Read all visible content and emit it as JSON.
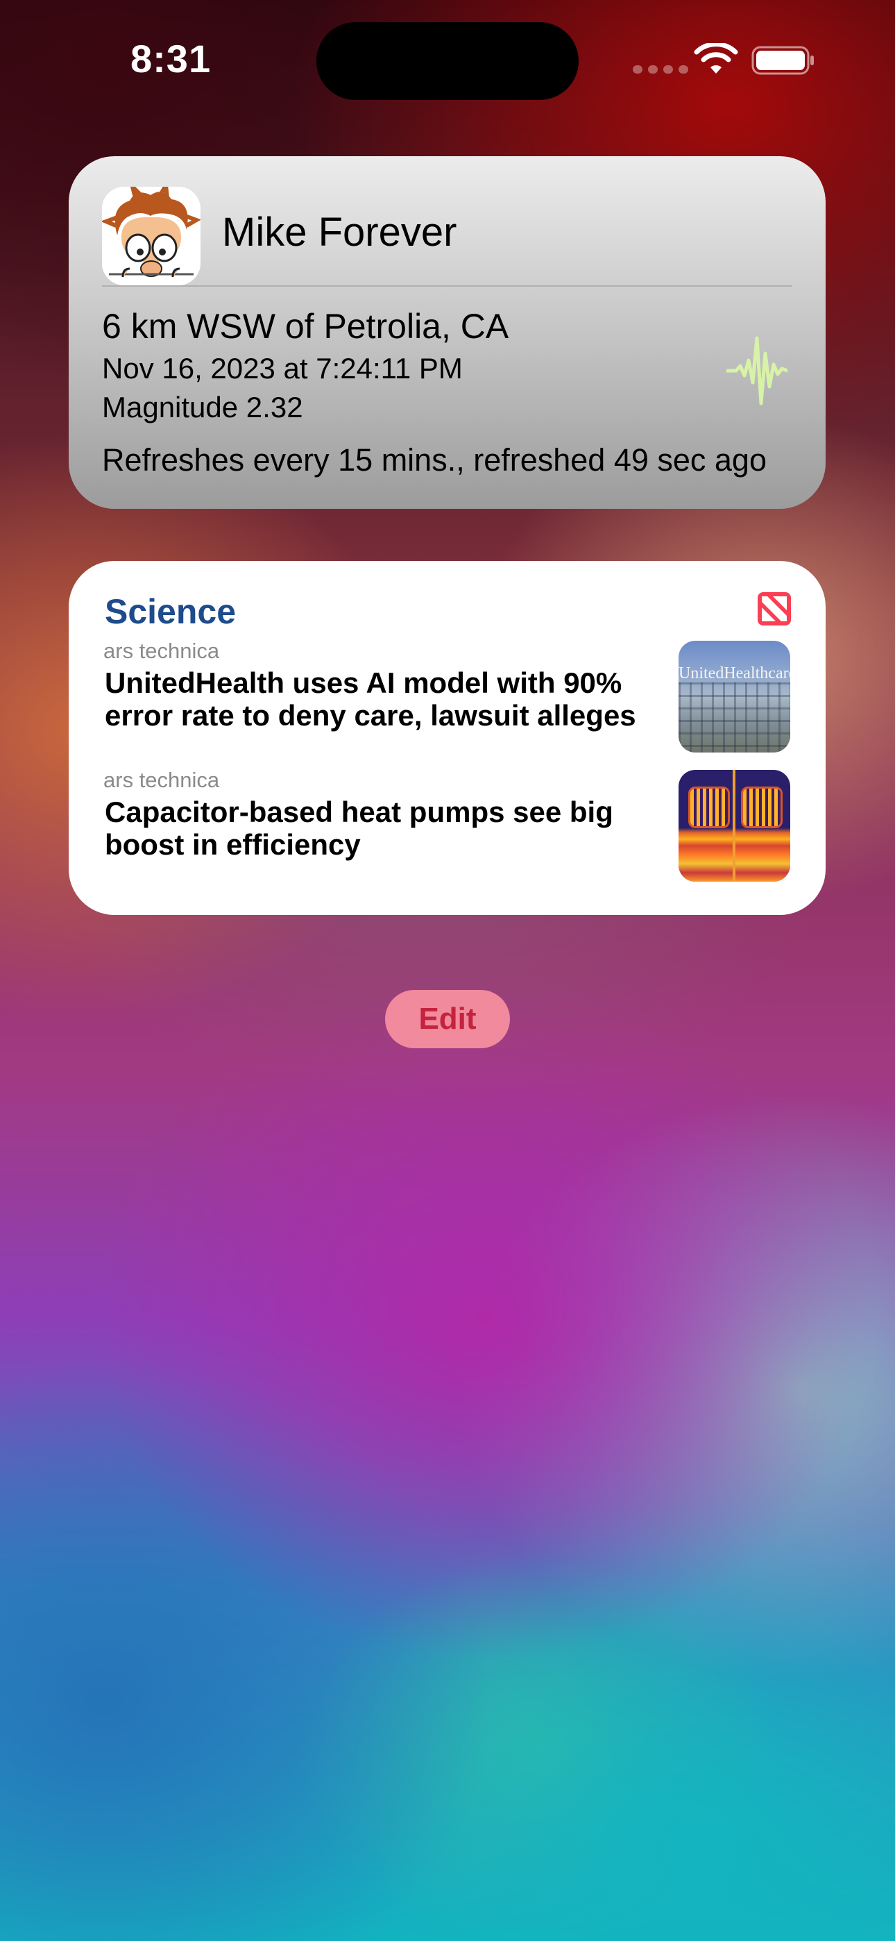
{
  "status_bar": {
    "time": "8:31"
  },
  "quake_widget": {
    "title": "Mike Forever",
    "location": "6 km WSW of Petrolia, CA",
    "datetime": "Nov 16, 2023 at 7:24:11 PM",
    "magnitude": "Magnitude 2.32",
    "refresh": "Refreshes every 15 mins., refreshed 49 sec ago",
    "app_icon": "cartoon-face-icon",
    "activity_icon": "seismograph-icon",
    "activity_color": "#d8f2a8"
  },
  "news_widget": {
    "section": "Science",
    "section_color": "#1e4b8c",
    "app_icon": "apple-news-icon",
    "articles": [
      {
        "source": "ars technica",
        "headline": "UnitedHealth uses AI model with 90% error rate to deny care, lawsuit alleges",
        "thumbnail_text": "UnitedHealthcare"
      },
      {
        "source": "ars technica",
        "headline": "Capacitor-based heat pumps see big boost in efficiency"
      }
    ]
  },
  "edit_button": {
    "label": "Edit"
  }
}
